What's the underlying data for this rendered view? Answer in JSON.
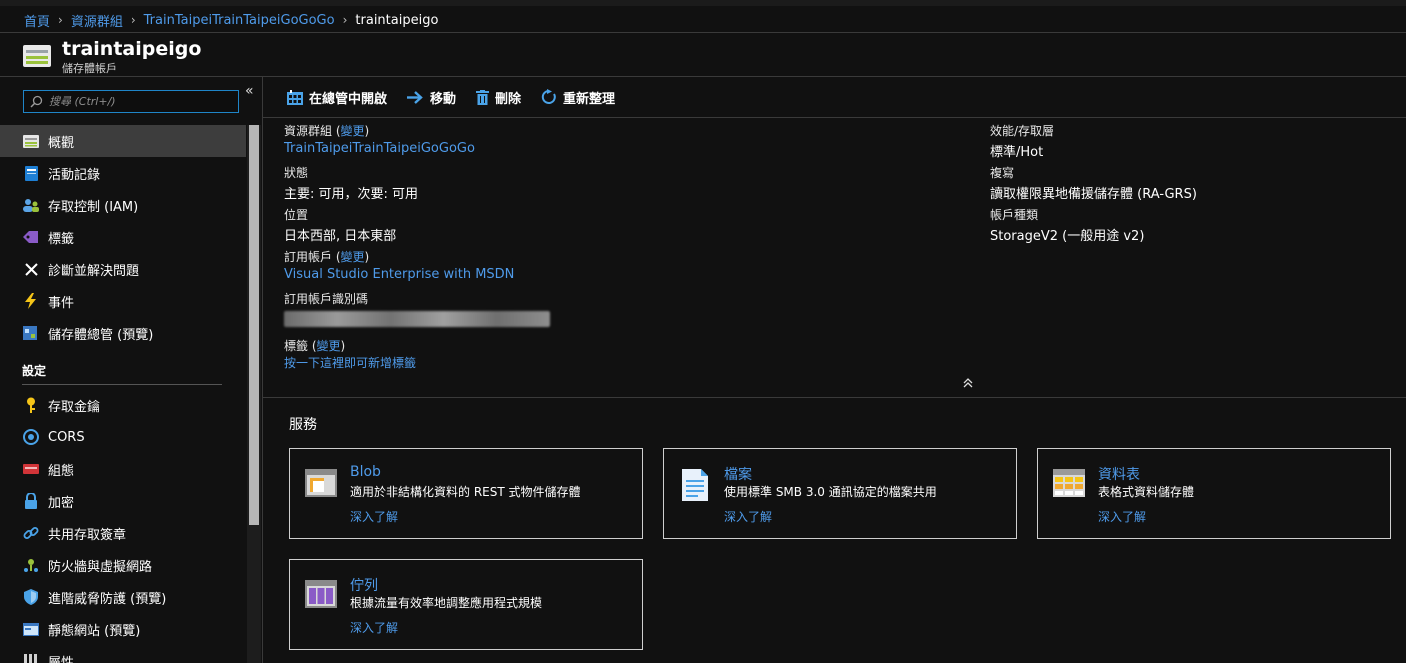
{
  "breadcrumb": {
    "items": [
      "首頁",
      "資源群組",
      "TrainTaipeiTrainTaipeiGoGoGo"
    ],
    "current": "traintaipeigo"
  },
  "resource": {
    "title": "traintaipeigo",
    "subtitle": "儲存體帳戶"
  },
  "sidebar": {
    "search_placeholder": "搜尋 (Ctrl+/)",
    "collapse_glyph": "«",
    "items": [
      {
        "label": "概觀",
        "icon": "storage-icon"
      },
      {
        "label": "活動記錄",
        "icon": "activity-log-icon"
      },
      {
        "label": "存取控制 (IAM)",
        "icon": "iam-icon"
      },
      {
        "label": "標籤",
        "icon": "tag-icon"
      },
      {
        "label": "診斷並解決問題",
        "icon": "wrench-icon"
      },
      {
        "label": "事件",
        "icon": "lightning-icon"
      },
      {
        "label": "儲存體總管 (預覽)",
        "icon": "explorer-icon"
      }
    ],
    "section_settings": "設定",
    "settings_items": [
      {
        "label": "存取金鑰",
        "icon": "key-icon"
      },
      {
        "label": "CORS",
        "icon": "cors-icon"
      },
      {
        "label": "組態",
        "icon": "config-icon"
      },
      {
        "label": "加密",
        "icon": "lock-icon"
      },
      {
        "label": "共用存取簽章",
        "icon": "link-icon"
      },
      {
        "label": "防火牆與虛擬網路",
        "icon": "firewall-icon"
      },
      {
        "label": "進階威脅防護 (預覽)",
        "icon": "shield-icon"
      },
      {
        "label": "靜態網站 (預覽)",
        "icon": "website-icon"
      },
      {
        "label": "屬性",
        "icon": "properties-icon"
      }
    ]
  },
  "toolbar": {
    "open_explorer": "在總管中開啟",
    "move": "移動",
    "delete": "刪除",
    "refresh": "重新整理"
  },
  "essentials": {
    "resource_group_label": "資源群組",
    "change": "變更",
    "resource_group_value": "TrainTaipeiTrainTaipeiGoGoGo",
    "status_label": "狀態",
    "status_value": "主要: 可用，次要: 可用",
    "location_label": "位置",
    "location_value": "日本西部, 日本東部",
    "subscription_label": "訂用帳戶",
    "subscription_value": "Visual Studio Enterprise with MSDN",
    "subscription_id_label": "訂用帳戶識別碼",
    "tags_label": "標籤",
    "tags_add": "按一下這裡即可新增標籤",
    "performance_label": "效能/存取層",
    "performance_value": "標準/Hot",
    "replication_label": "複寫",
    "replication_value": "讀取權限異地備援儲存體 (RA-GRS)",
    "account_kind_label": "帳戶種類",
    "account_kind_value": "StorageV2 (一般用途 v2)"
  },
  "services": {
    "title": "服務",
    "learn_more": "深入了解",
    "cards": [
      {
        "title": "Blob",
        "desc": "適用於非結構化資料的 REST 式物件儲存體",
        "icon": "blob-icon"
      },
      {
        "title": "檔案",
        "desc": "使用標準 SMB 3.0 通訊協定的檔案共用",
        "icon": "file-icon"
      },
      {
        "title": "資料表",
        "desc": "表格式資料儲存體",
        "icon": "table-icon"
      },
      {
        "title": "佇列",
        "desc": "根據流量有效率地調整應用程式規模",
        "icon": "queue-icon"
      }
    ]
  },
  "colors": {
    "background": "#111111",
    "accent_link": "#4f9bea",
    "active_nav": "#3d3d3d",
    "border": "#3a3a3a"
  }
}
